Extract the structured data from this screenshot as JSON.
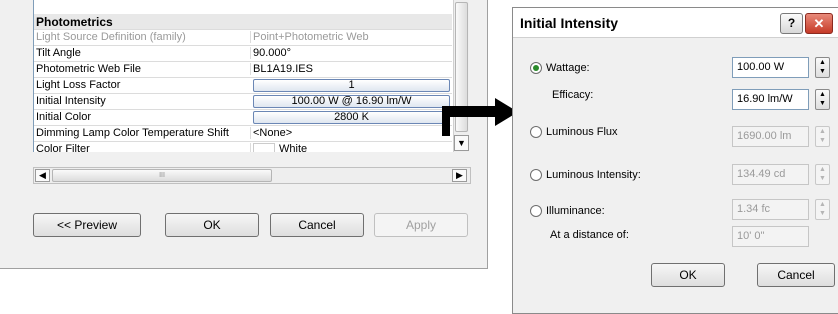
{
  "properties_grid": {
    "rows": [
      {
        "name": "Photometrics",
        "value": ""
      },
      {
        "name": "Light Source Definition (family)",
        "value": "Point+Photometric Web"
      },
      {
        "name": "Tilt Angle",
        "value": "90.000°"
      },
      {
        "name": "Photometric Web File",
        "value": "BL1A19.IES"
      },
      {
        "name": "Light Loss Factor",
        "value": "1"
      },
      {
        "name": "Initial Intensity",
        "value": "100.00 W @ 16.90 lm/W"
      },
      {
        "name": "Initial Color",
        "value": "2800 K"
      },
      {
        "name": "Dimming Lamp Color Temperature Shift",
        "value": "<None>"
      },
      {
        "name": "Color Filter",
        "value": "White"
      }
    ],
    "hscroll_thumb": "III"
  },
  "prop_dialog": {
    "preview_label": "<< Preview",
    "ok_label": "OK",
    "cancel_label": "Cancel",
    "apply_label": "Apply"
  },
  "intensity_dialog": {
    "title": "Initial Intensity",
    "help_label": "?",
    "close_label": "✕",
    "wattage_label": "Wattage:",
    "wattage_value": "100.00 W",
    "efficacy_label": "Efficacy:",
    "efficacy_value": "16.90 lm/W",
    "luminous_flux_label": "Luminous Flux",
    "luminous_flux_value": "1690.00 lm",
    "luminous_intensity_label": "Luminous Intensity:",
    "luminous_intensity_value": "134.49 cd",
    "illuminance_label": "Illuminance:",
    "illuminance_value": "1.34 fc",
    "distance_label": "At a distance of:",
    "distance_value": "10'  0\"",
    "ok_label": "OK",
    "cancel_label": "Cancel",
    "selected_option": "Wattage"
  },
  "colors": {
    "radio_selected": "#2a8a2a",
    "close_button": "#c53a27",
    "field_border": "#7f9db9",
    "arrow": "#000000"
  },
  "icons": {
    "scroll_up": "▲",
    "scroll_down": "▼",
    "scroll_left": "◀",
    "scroll_right": "▶"
  }
}
